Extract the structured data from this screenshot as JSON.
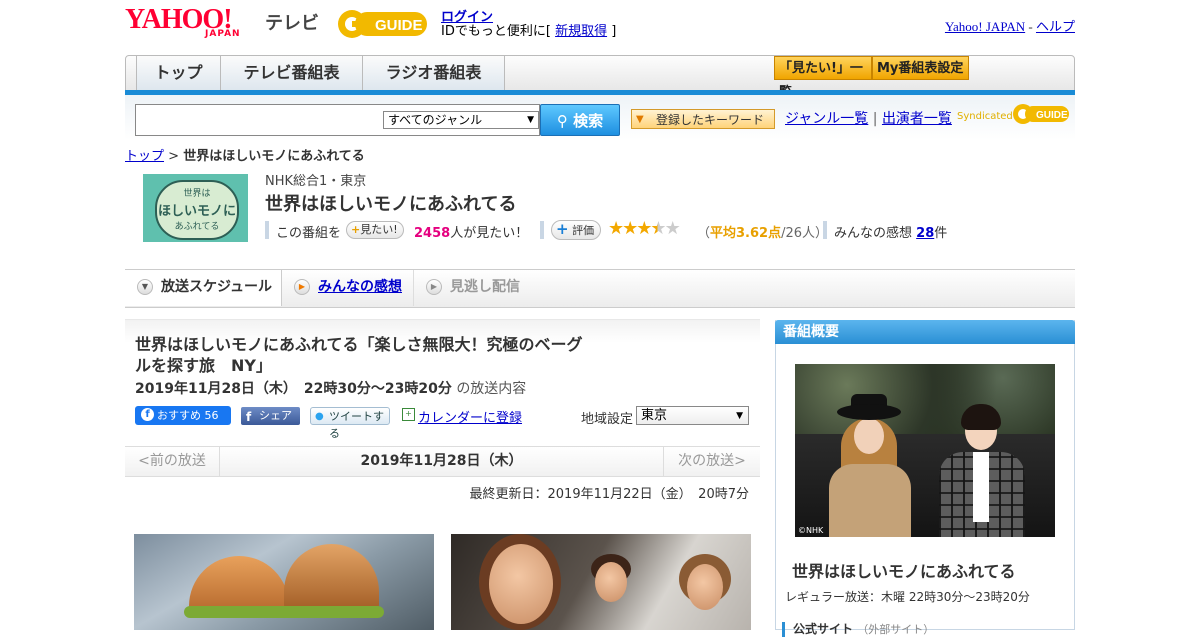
{
  "header": {
    "logo": "YAHOO!",
    "logo_sub": "JAPAN",
    "tv_label": "テレビ",
    "gguide_logo": "GUIDE",
    "login_link": "ログイン",
    "id_text_prefix": "IDでもっと便利に[ ",
    "signup_link": "新規取得",
    "id_text_suffix": " ]",
    "yahoo_japan_link": "Yahoo! JAPAN",
    "separator": " - ",
    "help_link": "ヘルプ"
  },
  "nav": {
    "tabs": [
      {
        "label": "トップ"
      },
      {
        "label": "テレビ番組表"
      },
      {
        "label": "ラジオ番組表"
      }
    ],
    "mitai_list_button": "「見たい!」一覧",
    "my_schedule_button": "My番組表設定"
  },
  "search": {
    "input_value": "",
    "genre_select": "すべてのジャンル",
    "search_button": "検索",
    "keyword_button": "登録したキーワード",
    "genre_link": "ジャンル一覧",
    "divider": "|",
    "performer_link": "出演者一覧",
    "syndicated": "Syndicated",
    "syndicated_logo": "GUIDE"
  },
  "breadcrumb": {
    "home": "トップ",
    "separator": " > ",
    "current": "世界はほしいモノにあふれてる"
  },
  "program": {
    "thumb_line1": "世界は",
    "thumb_line2": "ほしいモノに",
    "thumb_line3": "あふれてる",
    "channel": "NHK総合1・東京",
    "title": "世界はほしいモノにあふれてる",
    "this_program": "この番組を",
    "mitai_button": "見たい!",
    "mitai_count": "2458",
    "mitai_suffix": "人が見たい！",
    "rate_button": "評価",
    "rating": 3.62,
    "avg_prefix": "（",
    "avg_label": "平均3.62点",
    "avg_count": "/26人）",
    "impressions_label": "みんなの感想",
    "impressions_count": "28",
    "impressions_suffix": "件"
  },
  "tabs": [
    {
      "label": "放送スケジュール",
      "state": "active"
    },
    {
      "label": "みんなの感想",
      "state": "link"
    },
    {
      "label": "見逃し配信",
      "state": "disabled"
    }
  ],
  "episode": {
    "title": "世界はほしいモノにあふれてる「楽しさ無限大！究極のベーグルを探す旅　NY」",
    "date_time": "2019年11月28日（木）　22時30分～23時20分",
    "date_suffix": "の放送内容",
    "fb_label": "おすすめ 56",
    "share_label": "シェア",
    "tweet_label": "ツイートする",
    "calendar_label": "カレンダーに登録",
    "region_label": "地域設定",
    "region_value": "東京",
    "prev": "<前の放送",
    "current_date": "2019年11月28日（木）",
    "next": "次の放送>",
    "updated": "最終更新日：2019年11月22日（金）　20時7分"
  },
  "sidebar": {
    "header": "番組概要",
    "photo_credit": "©NHK",
    "title": "世界はほしいモノにあふれてる",
    "regular": "レギュラー放送：木曜 22時30分～23時20分",
    "official_site": "公式サイト",
    "official_site_note": "（外部サイト）"
  },
  "colors": {
    "yahoo_red": "#ff0033",
    "nav_blue": "#1a8bd6",
    "link": "#0000cc",
    "pink": "#e5007f",
    "star": "#f3a800"
  }
}
